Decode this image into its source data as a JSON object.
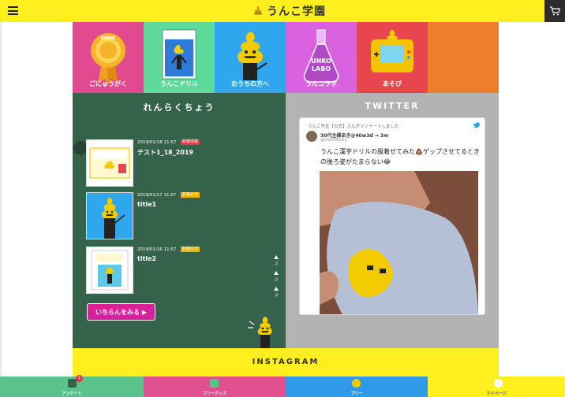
{
  "header": {
    "logo_text": "うんこ学園",
    "menu_icon": "hamburger-icon",
    "cart_icon": "cart-icon",
    "bg_color": "#ffef1e"
  },
  "nav": {
    "tiles": [
      {
        "label": "ごにゅうがく",
        "color": "#e14a8e",
        "icon": "rosette-badge-icon"
      },
      {
        "label": "うんこドリル",
        "color": "#5edb9c",
        "icon": "drill-book-icon"
      },
      {
        "label": "おうちの方へ",
        "color": "#2fa7ee",
        "icon": "unko-sensei-icon"
      },
      {
        "label": "うんコラボ",
        "color": "#d862e0",
        "icon": "unko-labo-flask-icon"
      },
      {
        "label": "あそび",
        "color": "#e8464e",
        "icon": "game-console-icon"
      },
      {
        "label": "",
        "color": "#f07d2a",
        "icon": ""
      }
    ]
  },
  "renraku": {
    "title": "れんらくちょう",
    "bg_color": "#35624a",
    "items": [
      {
        "date": "2019/01/18 11:57",
        "badge": "新着情報",
        "badge_color": "#e8364b",
        "title": "テスト1_18_2019"
      },
      {
        "date": "2019/01/17 11:57",
        "badge": "お知らせ",
        "badge_color": "#e8b800",
        "title": "title1"
      },
      {
        "date": "2019/01/16 11:57",
        "badge": "お知らせ",
        "badge_color": "#e8b800",
        "title": "title2"
      }
    ],
    "more_button": "いちらんをみる ▶",
    "scroll_labels": [
      "ぷ",
      "ぷ",
      "ぷ"
    ]
  },
  "twitter": {
    "title": "TWITTER",
    "retweet_line": "うんこ先生【公式】さんがリツイートしました",
    "user_name": "30代主婦あき@40w3d → 3m",
    "user_handle": "@mom06252",
    "tweet_text": "うんこ漢字ドリルの服着せてみた💩ゲップさせてるときの後ろ姿がたまらない😂"
  },
  "instagram": {
    "title": "INSTAGRAM"
  },
  "bottom_nav": [
    {
      "label": "アンケート",
      "color": "#5ac38c",
      "badge": "1",
      "icon": "survey-icon"
    },
    {
      "label": "プリーグッズ",
      "color": "#e0508f",
      "badge": "",
      "icon": "goods-icon"
    },
    {
      "label": "プリー",
      "color": "#2f9ae8",
      "badge": "",
      "icon": "coin-icon"
    },
    {
      "label": "マイページ",
      "color": "#ffef1e",
      "badge": "",
      "icon": "mypage-icon"
    }
  ]
}
